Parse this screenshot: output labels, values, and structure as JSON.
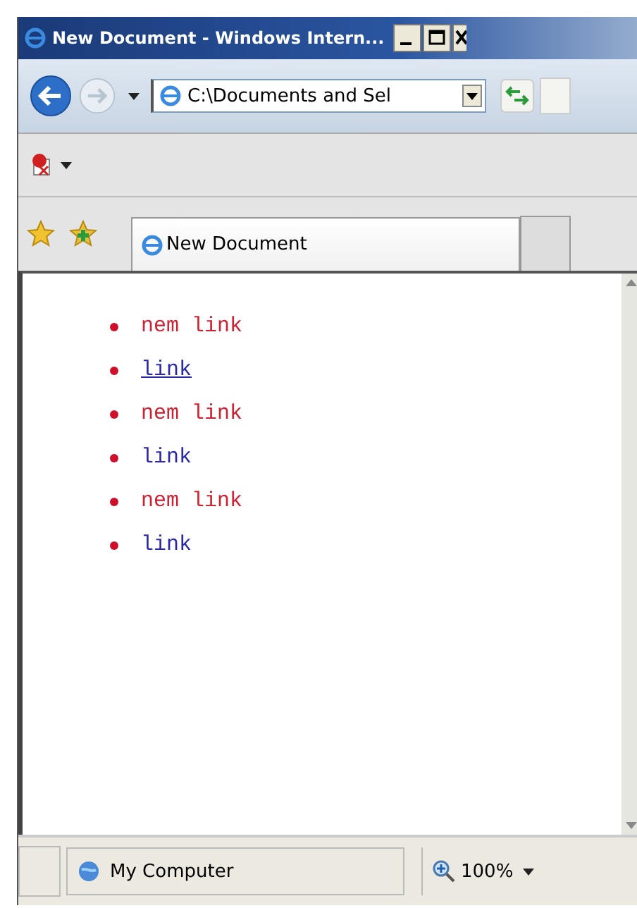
{
  "window": {
    "title": "New Document - Windows Intern..."
  },
  "address_bar": {
    "value": "C:\\Documents and Sel"
  },
  "tabs": [
    {
      "label": "New Document",
      "selected": true
    }
  ],
  "page": {
    "links": [
      {
        "text": "nem link",
        "kind": "visited",
        "hovered": false
      },
      {
        "text": "link",
        "kind": "unvisited",
        "hovered": true
      },
      {
        "text": "nem link",
        "kind": "visited",
        "hovered": false
      },
      {
        "text": "link",
        "kind": "unvisited",
        "hovered": false
      },
      {
        "text": "nem link",
        "kind": "visited",
        "hovered": false
      },
      {
        "text": "link",
        "kind": "unvisited",
        "hovered": false
      }
    ]
  },
  "status_bar": {
    "zone": "My Computer",
    "zoom": "100%"
  }
}
